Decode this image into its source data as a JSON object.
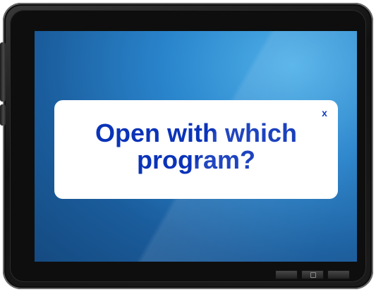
{
  "dialog": {
    "title": "Open with which program?",
    "close_label": "x"
  },
  "colors": {
    "dialog_text": "#0a33b8",
    "screen": "#2a85cc",
    "bezel": "#111111"
  },
  "icons": {
    "close": "close-icon",
    "home": "home-icon"
  }
}
